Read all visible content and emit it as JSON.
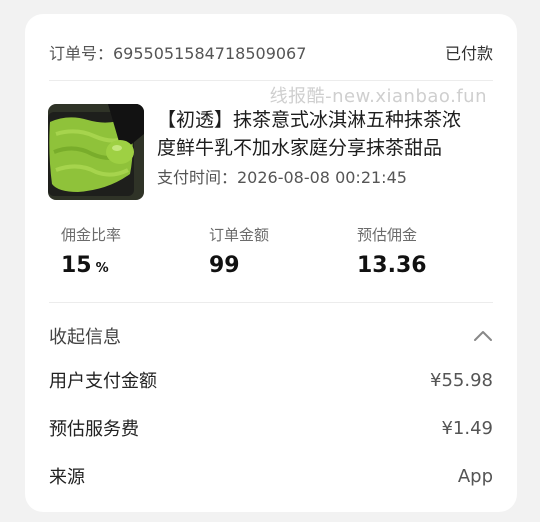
{
  "order": {
    "number_label": "订单号：6955051584718509067",
    "status": "已付款"
  },
  "watermark": "线报酷-new.xianbao.fun",
  "product": {
    "title_line1": "【初透】抹茶意式冰淇淋五种抹茶浓",
    "title_line2": "度鲜牛乳不加水家庭分享抹茶甜品",
    "pay_time": "支付时间：2026-08-08 00:21:45",
    "image_icon": "matcha-ice-cream-image"
  },
  "stats": [
    {
      "label": "佣金比率",
      "value": "15",
      "unit": "%"
    },
    {
      "label": "订单金额",
      "value": "99",
      "unit": ""
    },
    {
      "label": "预估佣金",
      "value": "13.36",
      "unit": ""
    }
  ],
  "details": {
    "collapse_label": "收起信息",
    "collapse_icon": "chevron-up-icon",
    "rows": [
      {
        "key": "用户支付金额",
        "value": "¥55.98"
      },
      {
        "key": "预估服务费",
        "value": "¥1.49"
      },
      {
        "key": "来源",
        "value": "App"
      }
    ]
  },
  "colors": {
    "page_bg": "#f2f2f2",
    "card_bg": "#ffffff",
    "matcha_green": "#8bc34a"
  }
}
